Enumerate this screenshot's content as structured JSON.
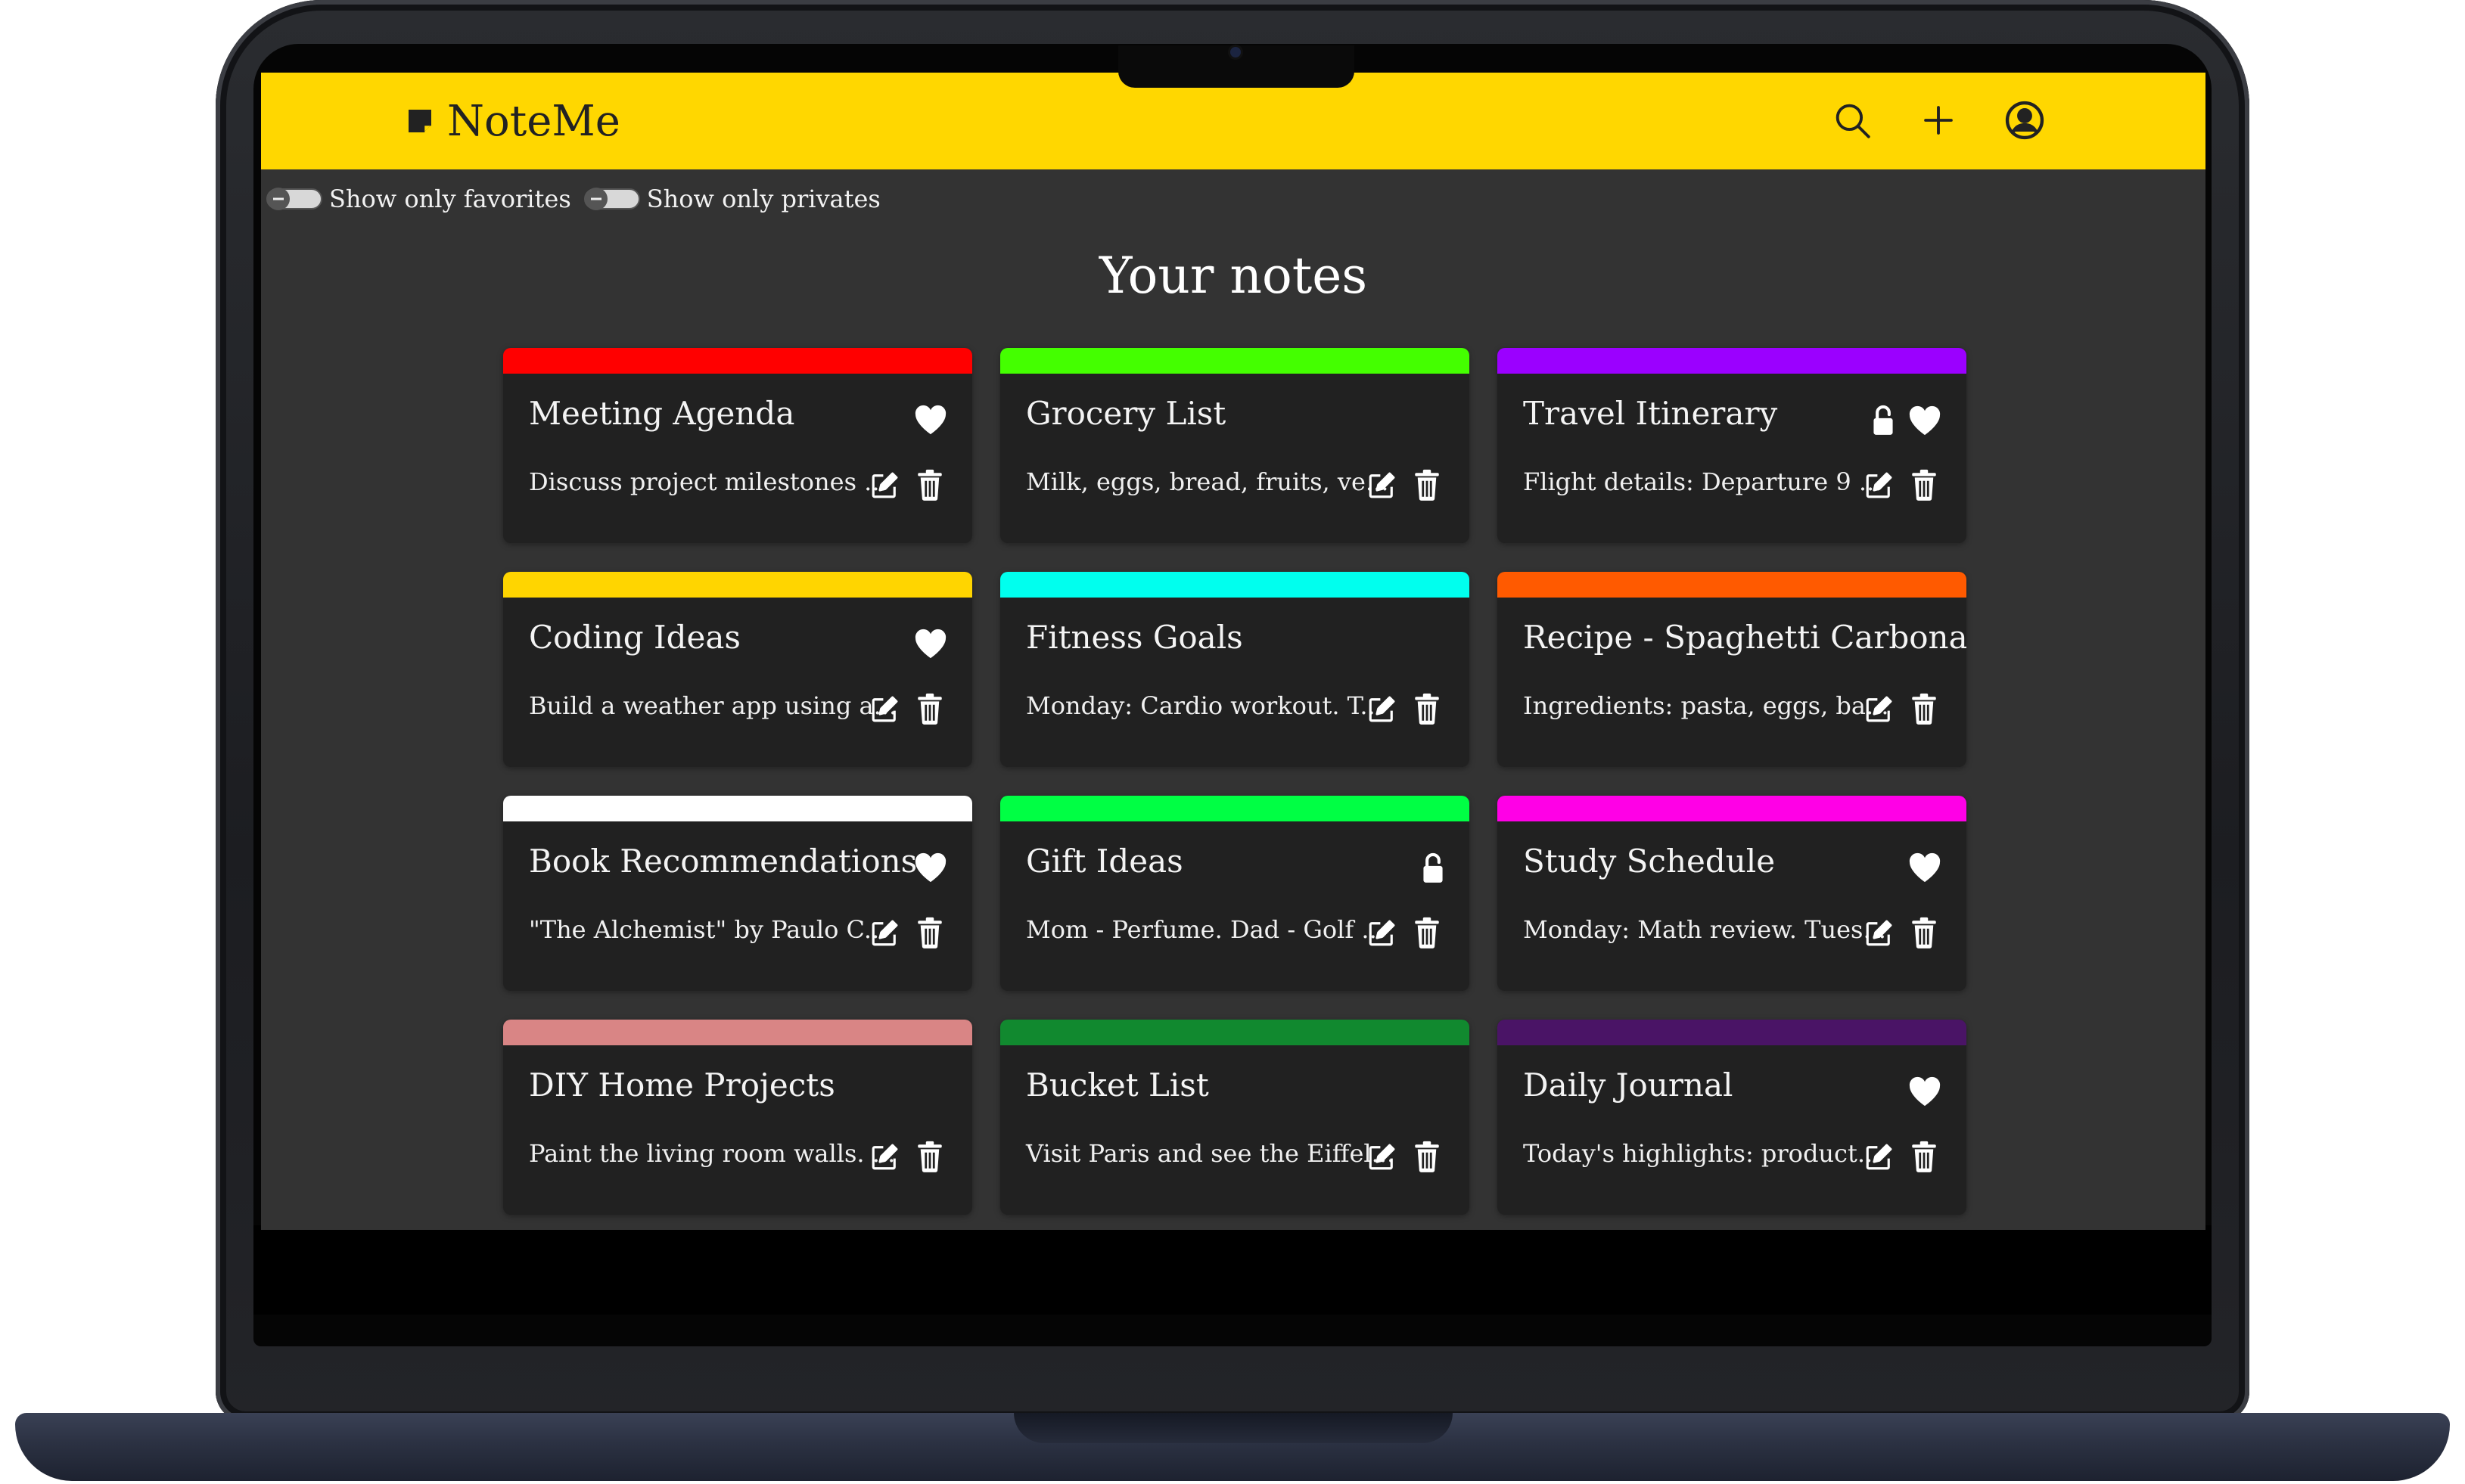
{
  "app": {
    "name": "NoteMe"
  },
  "nav": {
    "icons": [
      "search-icon",
      "plus-icon",
      "user-circle-icon"
    ]
  },
  "filters": [
    {
      "label": "Show only favorites",
      "checked": false
    },
    {
      "label": "Show only privates",
      "checked": false
    }
  ],
  "page": {
    "title": "Your notes"
  },
  "notes": [
    {
      "title": "Meeting Agenda",
      "preview": "Discuss project milestones ...",
      "color": "#ff0000",
      "favorite": true,
      "private": false
    },
    {
      "title": "Grocery List",
      "preview": "Milk, eggs, bread, fruits, ve...",
      "color": "#44ff00",
      "favorite": false,
      "private": false
    },
    {
      "title": "Travel Itinerary",
      "preview": "Flight details: Departure 9 ...",
      "color": "#9b00ff",
      "favorite": true,
      "private": true
    },
    {
      "title": "Coding Ideas",
      "preview": "Build a weather app using a...",
      "color": "#ffd500",
      "favorite": true,
      "private": false
    },
    {
      "title": "Fitness Goals",
      "preview": "Monday: Cardio workout. T...",
      "color": "#00ffee",
      "favorite": false,
      "private": false
    },
    {
      "title": "Recipe - Spaghetti Carbonara",
      "preview": "Ingredients: pasta, eggs, ba...",
      "color": "#ff5a00",
      "favorite": false,
      "private": false
    },
    {
      "title": "Book Recommendations",
      "preview": "\"The Alchemist\" by Paulo C...",
      "color": "#ffffff",
      "favorite": true,
      "private": false
    },
    {
      "title": "Gift Ideas",
      "preview": "Mom - Perfume. Dad - Golf ...",
      "color": "#00ff44",
      "favorite": false,
      "private": true
    },
    {
      "title": "Study Schedule",
      "preview": "Monday: Math review. Tues...",
      "color": "#ff00e6",
      "favorite": true,
      "private": false
    },
    {
      "title": "DIY Home Projects",
      "preview": "Paint the living room walls. ...",
      "color": "#d98585",
      "favorite": false,
      "private": false
    },
    {
      "title": "Bucket List",
      "preview": "Visit Paris and see the Eiffel...",
      "color": "#11892f",
      "favorite": false,
      "private": false
    },
    {
      "title": "Daily Journal",
      "preview": "Today's highlights: product...",
      "color": "#4a1466",
      "favorite": true,
      "private": false
    }
  ],
  "colors": {
    "navbar": "#ffd700",
    "background": "#333333",
    "card": "#212121",
    "text": "#ffffff"
  }
}
